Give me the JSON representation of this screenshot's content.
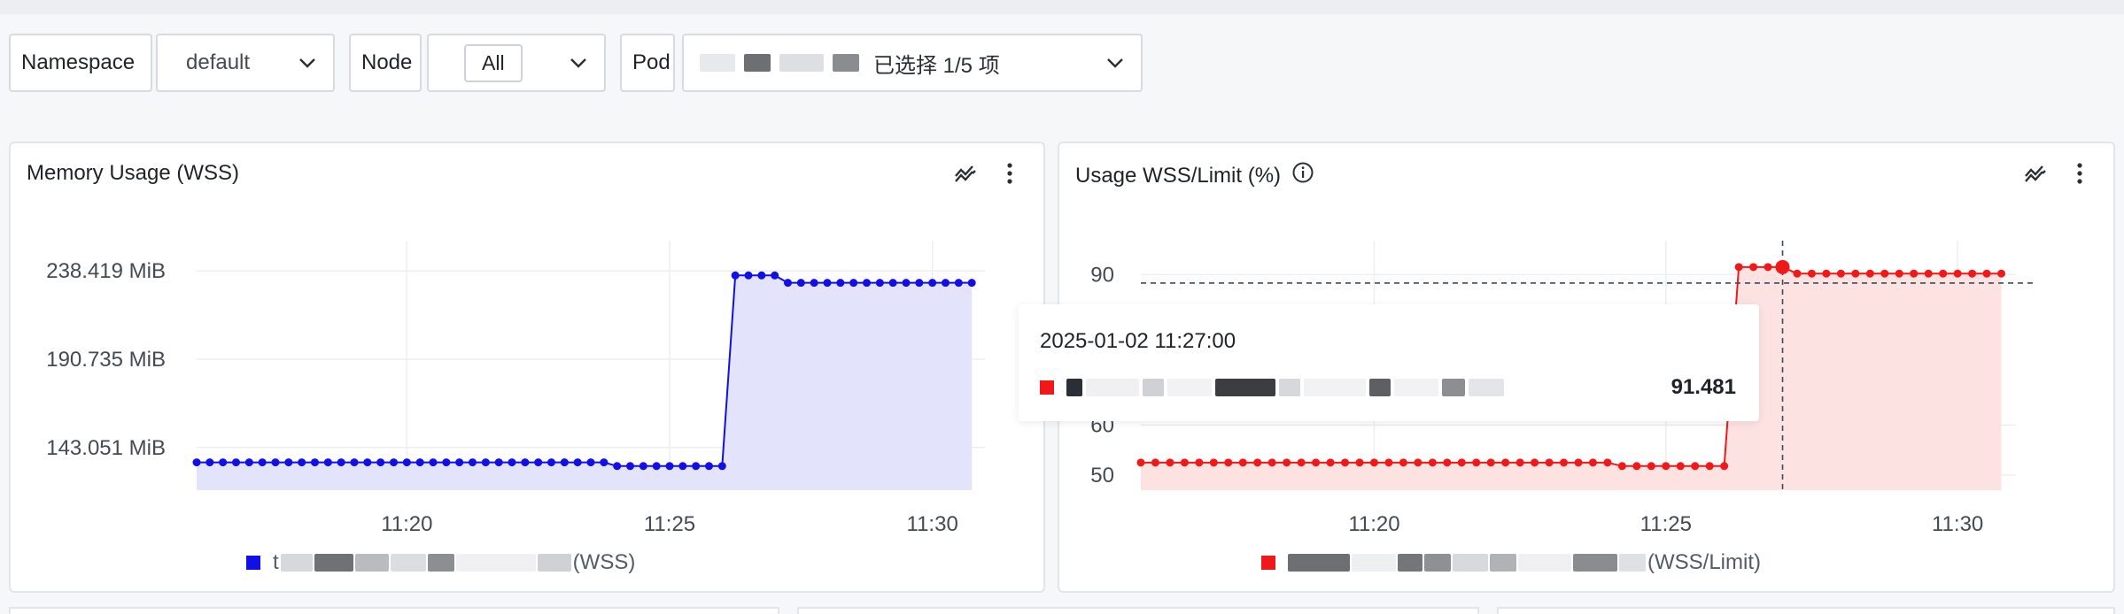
{
  "filters": {
    "namespace_label": "Namespace",
    "namespace_value": "default",
    "node_label": "Node",
    "node_value": "All",
    "pod_label": "Pod",
    "pod_value_obscured": "t... ...",
    "pod_selected": "已选择 1/5 项"
  },
  "panels": [
    {
      "title": "Memory Usage (WSS)",
      "legend": "(WSS)"
    },
    {
      "title": "Usage WSS/Limit (%)",
      "legend": "(WSS/Limit)"
    }
  ],
  "tooltip": {
    "time": "2025-01-02 11:27:00",
    "value": "91.481"
  },
  "colors": {
    "memory": "#1010e6",
    "memory_fill": "#e3e4fb",
    "usage": "#f01818",
    "usage_fill": "#fde2e2"
  },
  "chart_data": [
    {
      "type": "line",
      "title": "Memory Usage (WSS)",
      "x_ticks": [
        "11:20",
        "11:25",
        "11:30"
      ],
      "y_ticks": [
        "143.051 MiB",
        "190.735 MiB",
        "238.419 MiB"
      ],
      "ylim": [
        120,
        250
      ],
      "xlim": [
        "11:16",
        "11:31"
      ],
      "series": [
        {
          "name": "(WSS)",
          "x": [
            "11:16",
            "11:16:15",
            "11:16:30",
            "11:16:45",
            "11:17",
            "11:17:15",
            "11:17:30",
            "11:17:45",
            "11:18",
            "11:18:15",
            "11:18:30",
            "11:18:45",
            "11:19",
            "11:19:15",
            "11:19:30",
            "11:19:45",
            "11:20",
            "11:20:15",
            "11:20:30",
            "11:20:45",
            "11:21",
            "11:21:15",
            "11:21:30",
            "11:21:45",
            "11:22",
            "11:22:15",
            "11:22:30",
            "11:22:45",
            "11:23",
            "11:23:15",
            "11:23:30",
            "11:23:45",
            "11:24",
            "11:24:15",
            "11:24:30",
            "11:24:45",
            "11:25",
            "11:25:15",
            "11:25:30",
            "11:25:45",
            "11:26",
            "11:26:15",
            "11:26:30",
            "11:26:45",
            "11:27",
            "11:27:15",
            "11:27:30",
            "11:27:45",
            "11:28",
            "11:28:15",
            "11:28:30",
            "11:28:45",
            "11:29",
            "11:29:15",
            "11:29:30",
            "11:29:45",
            "11:30",
            "11:30:15",
            "11:30:30",
            "11:30:45"
          ],
          "values": [
            135,
            135,
            135,
            135,
            135,
            135,
            135,
            135,
            135,
            135,
            135,
            135,
            135,
            135,
            135,
            135,
            135,
            135,
            135,
            135,
            135,
            135,
            135,
            135,
            135,
            135,
            135,
            135,
            135,
            135,
            135,
            135,
            133,
            133,
            133,
            133,
            133,
            133,
            133,
            133,
            133,
            236,
            236,
            236,
            236,
            232,
            232,
            232,
            232,
            232,
            232,
            232,
            232,
            232,
            232,
            232,
            232,
            232,
            232,
            232
          ]
        }
      ]
    },
    {
      "type": "line",
      "title": "Usage WSS/Limit (%)",
      "x_ticks": [
        "11:20",
        "11:25",
        "11:30"
      ],
      "y_ticks": [
        "50",
        "60",
        "90"
      ],
      "ylim": [
        47,
        95
      ],
      "xlim": [
        "11:16",
        "11:31"
      ],
      "series": [
        {
          "name": "(WSS/Limit)",
          "x": [
            "11:16",
            "11:16:15",
            "11:16:30",
            "11:16:45",
            "11:17",
            "11:17:15",
            "11:17:30",
            "11:17:45",
            "11:18",
            "11:18:15",
            "11:18:30",
            "11:18:45",
            "11:19",
            "11:19:15",
            "11:19:30",
            "11:19:45",
            "11:20",
            "11:20:15",
            "11:20:30",
            "11:20:45",
            "11:21",
            "11:21:15",
            "11:21:30",
            "11:21:45",
            "11:22",
            "11:22:15",
            "11:22:30",
            "11:22:45",
            "11:23",
            "11:23:15",
            "11:23:30",
            "11:23:45",
            "11:24",
            "11:24:15",
            "11:24:30",
            "11:24:45",
            "11:25",
            "11:25:15",
            "11:25:30",
            "11:25:45",
            "11:26",
            "11:26:15",
            "11:26:30",
            "11:26:45",
            "11:27",
            "11:27:15",
            "11:27:30",
            "11:27:45",
            "11:28",
            "11:28:15",
            "11:28:30",
            "11:28:45",
            "11:29",
            "11:29:15",
            "11:29:30",
            "11:29:45",
            "11:30",
            "11:30:15",
            "11:30:30",
            "11:30:45"
          ],
          "values": [
            52.5,
            52.5,
            52.5,
            52.5,
            52.5,
            52.5,
            52.5,
            52.5,
            52.5,
            52.5,
            52.5,
            52.5,
            52.5,
            52.5,
            52.5,
            52.5,
            52.5,
            52.5,
            52.5,
            52.5,
            52.5,
            52.5,
            52.5,
            52.5,
            52.5,
            52.5,
            52.5,
            52.5,
            52.5,
            52.5,
            52.5,
            52.5,
            52.5,
            51.8,
            51.8,
            51.8,
            51.8,
            51.8,
            51.8,
            51.8,
            51.8,
            91.5,
            91.5,
            91.5,
            91.5,
            90.2,
            90.2,
            90.2,
            90.2,
            90.2,
            90.2,
            90.2,
            90.2,
            90.2,
            90.2,
            90.2,
            90.2,
            90.2,
            90.2,
            90.2
          ]
        }
      ]
    }
  ]
}
